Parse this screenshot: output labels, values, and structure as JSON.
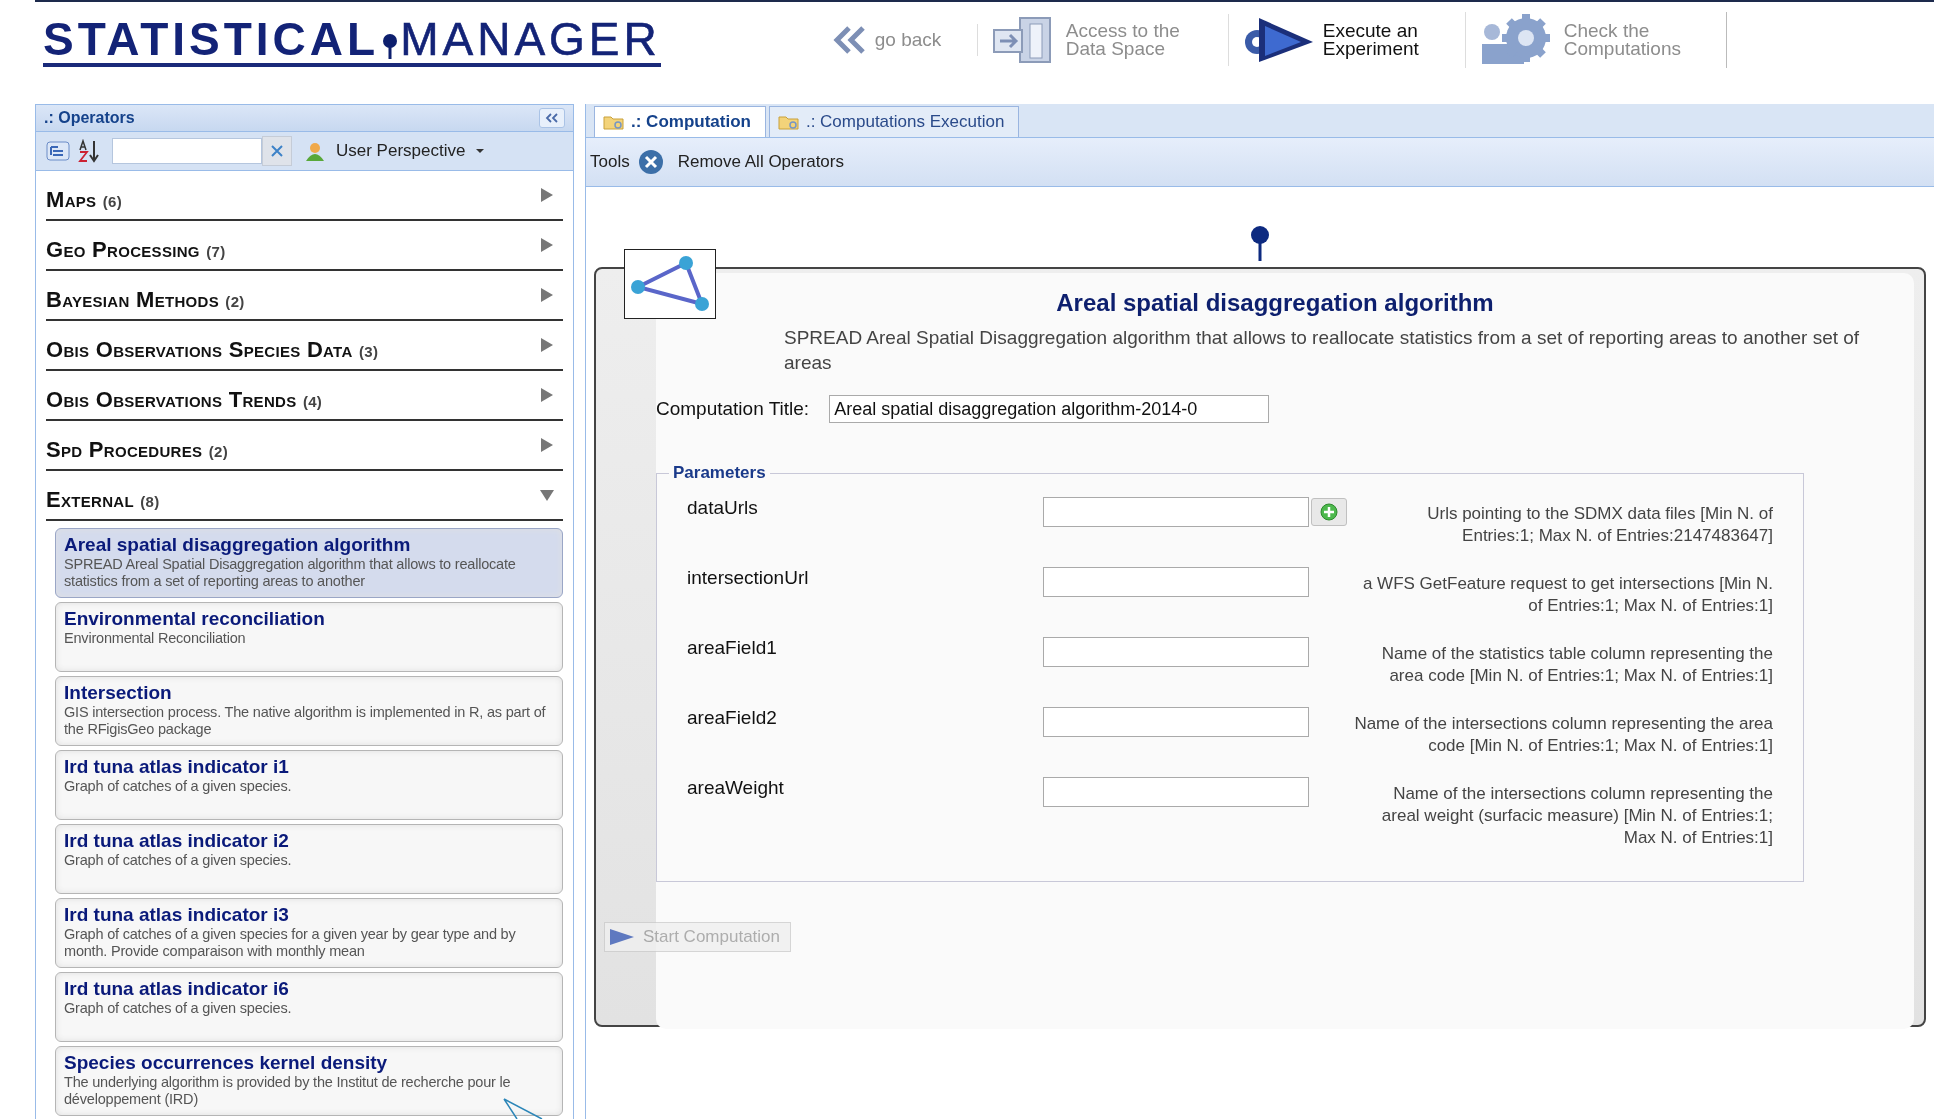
{
  "header": {
    "logo": {
      "part_1": "STATISTICAL",
      "part_2": "MANAGER"
    },
    "nav": [
      {
        "kind": "back",
        "label": "go back",
        "disabled": true
      },
      {
        "kind": "data",
        "label": "Access to the Data Space",
        "disabled": true
      },
      {
        "kind": "execute",
        "label": "Execute an Experiment",
        "disabled": false
      },
      {
        "kind": "check",
        "label": "Check the Computations",
        "disabled": true
      }
    ]
  },
  "sidebar": {
    "title": ".: Operators",
    "perspective": "User Perspective",
    "categories": [
      {
        "name": "Maps",
        "count": "(6)",
        "expanded": false
      },
      {
        "name": "Geo Processing",
        "count": "(7)",
        "expanded": false
      },
      {
        "name": "Bayesian Methods",
        "count": "(2)",
        "expanded": false
      },
      {
        "name": "Obis Observations Species Data",
        "count": "(3)",
        "expanded": false
      },
      {
        "name": "Obis Observations Trends",
        "count": "(4)",
        "expanded": false
      },
      {
        "name": "Spd Procedures",
        "count": "(2)",
        "expanded": false
      },
      {
        "name": "External",
        "count": "(8)",
        "expanded": true,
        "children": [
          {
            "title": "Areal spatial disaggregation algorithm",
            "description": "SPREAD Areal Spatial Disaggregation algorithm that allows to reallocate statistics from a set of reporting areas to another",
            "selected": true
          },
          {
            "title": "Environmental reconciliation",
            "description": "Environmental Reconciliation",
            "selected": false
          },
          {
            "title": "Intersection",
            "description": "GIS intersection process. The native algorithm is implemented in R, as part of the RFigisGeo package",
            "selected": false
          },
          {
            "title": "Ird tuna atlas indicator i1",
            "description": "Graph of catches of a given species.",
            "selected": false
          },
          {
            "title": "Ird tuna atlas indicator i2",
            "description": "Graph of catches of a given species.",
            "selected": false
          },
          {
            "title": "Ird tuna atlas indicator i3",
            "description": "Graph of catches of a given species for a given year by gear type and by month. Provide comparaison with monthly mean",
            "selected": false
          },
          {
            "title": "Ird tuna atlas indicator i6",
            "description": "Graph of catches of a given species.",
            "selected": false
          },
          {
            "title": "Species occurrences kernel density",
            "description": "The underlying algorithm is provided by the Institut de recherche pour le développement (IRD)",
            "selected": false
          }
        ]
      }
    ]
  },
  "tabs": [
    {
      "label": ".: Computation",
      "selected": true
    },
    {
      "label": ".: Computations Execution",
      "selected": false
    }
  ],
  "toolbar": {
    "label": "Tools",
    "button": "Remove All Operators"
  },
  "operator": {
    "title": "Areal spatial disaggregation algorithm",
    "description": "SPREAD Areal Spatial Disaggregation algorithm that allows to reallocate statistics from a set of reporting areas to another set of areas",
    "computation_title": {
      "label": "Computation Title:",
      "value": "Areal spatial disaggregation algorithm-2014-0"
    },
    "parameters": {
      "legend": "Parameters",
      "items": [
        {
          "name": "dataUrls",
          "multiple": true,
          "description": "Urls pointing to the SDMX data files [Min N. of Entries:1; Max N. of Entries:2147483647]"
        },
        {
          "name": "intersectionUrl",
          "multiple": false,
          "description": "a WFS GetFeature request to get intersections [Min N. of Entries:1; Max N. of Entries:1]"
        },
        {
          "name": "areaField1",
          "multiple": false,
          "description": "Name of the statistics table column representing the area code [Min N. of Entries:1; Max N. of Entries:1]"
        },
        {
          "name": "areaField2",
          "multiple": false,
          "description": "Name of the intersections column representing the area code [Min N. of Entries:1; Max N. of Entries:1]"
        },
        {
          "name": "areaWeight",
          "multiple": false,
          "description": "Name of the intersections column representing the areal weight (surfacic measure) [Min N. of Entries:1; Max N. of Entries:1]"
        }
      ]
    },
    "start_button": {
      "label": "Start Computation",
      "disabled": true
    }
  }
}
